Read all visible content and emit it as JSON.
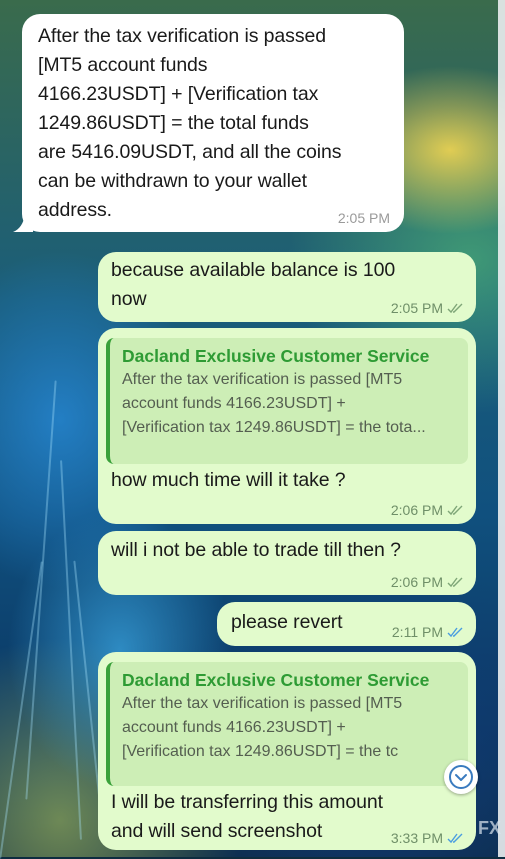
{
  "colors": {
    "incoming_bubble": "#ffffff",
    "outgoing_bubble": "#e2fbcc",
    "quote_bar": "#3aa13a",
    "quote_title": "#2e9b34",
    "read_ticks": "#4a9de0"
  },
  "messages": [
    {
      "direction": "incoming",
      "lines": [
        "After the tax verification is passed",
        "[MT5 account funds",
        "4166.23USDT] + [Verification tax",
        "1249.86USDT] = the total funds",
        "are 5416.09USDT, and all the coins",
        "can be withdrawn to your wallet",
        "address."
      ],
      "time": "2:05 PM"
    },
    {
      "direction": "outgoing",
      "lines": [
        "because available balance is 100",
        "now"
      ],
      "time": "2:05 PM",
      "status": "delivered"
    },
    {
      "direction": "outgoing",
      "reply_to": {
        "author": "Dacland Exclusive Customer Service",
        "lines": [
          "After the tax verification is passed [MT5",
          "account funds 4166.23USDT] +",
          "[Verification tax 1249.86USDT] = the tota..."
        ]
      },
      "lines": [
        "how much time will it take ?"
      ],
      "time": "2:06 PM",
      "status": "delivered"
    },
    {
      "direction": "outgoing",
      "lines": [
        "will i not be able to trade till then ?"
      ],
      "time": "2:06 PM",
      "status": "delivered"
    },
    {
      "direction": "outgoing",
      "lines": [
        "please revert"
      ],
      "time": "2:11 PM",
      "status": "read"
    },
    {
      "direction": "outgoing",
      "reply_to": {
        "author": "Dacland Exclusive Customer Service",
        "lines": [
          "After the tax verification is passed [MT5",
          "account funds 4166.23USDT] +",
          "[Verification tax 1249.86USDT] = the tc"
        ]
      },
      "lines": [
        "I will be transferring this amount",
        "and will send screenshot"
      ],
      "time": "3:33 PM",
      "status": "read"
    }
  ],
  "scroll_down_icon": "chevron-down-circle-icon",
  "watermark": "FX"
}
